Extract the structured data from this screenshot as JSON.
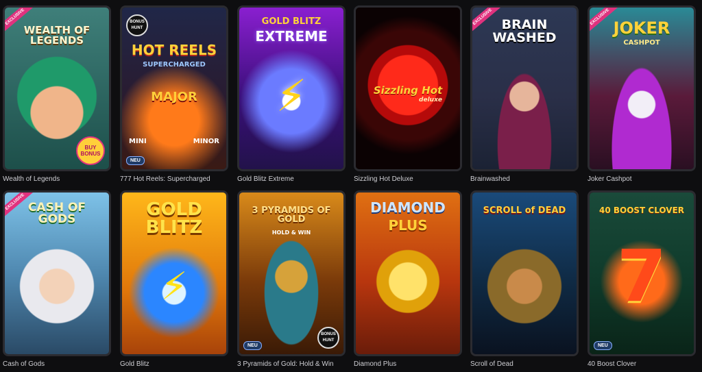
{
  "games": [
    {
      "name": "Wealth of Legends",
      "logo": "WEALTH OF LEGENDS",
      "badge": "EXCLUSIVE",
      "bonus": "BUY BONUS"
    },
    {
      "name": "777 Hot Reels: Supercharged",
      "logo": "HOT REELS",
      "logo_sub": "SUPERCHARGED",
      "labels": [
        "MAJOR",
        "MINI",
        "MINOR"
      ],
      "badge": "NEU",
      "corner": "BONUS HUNT"
    },
    {
      "name": "Gold Blitz Extreme",
      "logo": "GOLD BLITZ",
      "logo_sub": "EXTREME"
    },
    {
      "name": "Sizzling Hot Deluxe",
      "logo": "Sizzling Hot",
      "logo_sub": "deluxe"
    },
    {
      "name": "Brainwashed",
      "logo": "BRAIN WASHED",
      "badge": "EXCLUSIVE"
    },
    {
      "name": "Joker Cashpot",
      "logo": "JOKER",
      "logo_sub": "CASHPOT",
      "badge": "EXCLUSIVE"
    },
    {
      "name": "Cash of Gods",
      "logo": "CASH OF GODS",
      "badge": "EXCLUSIVE"
    },
    {
      "name": "Gold Blitz",
      "logo": "GOLD BLITZ"
    },
    {
      "name": "3 Pyramids of Gold: Hold & Win",
      "logo": "3 PYRAMIDS OF GOLD",
      "logo_sub": "HOLD & WIN",
      "badge": "NEU",
      "corner": "BONUS HUNT"
    },
    {
      "name": "Diamond Plus",
      "logo": "DIAMOND",
      "logo_sub": "PLUS"
    },
    {
      "name": "Scroll of Dead",
      "logo": "SCROLL of DEAD"
    },
    {
      "name": "40 Boost Clover",
      "logo": "40 BOOST CLOVER",
      "badge": "NEU"
    }
  ],
  "colors": {
    "background": "#0e0e10",
    "caption": "#cfcfd4",
    "exclusive": "#e0327e",
    "neu": "#1f3b66"
  }
}
